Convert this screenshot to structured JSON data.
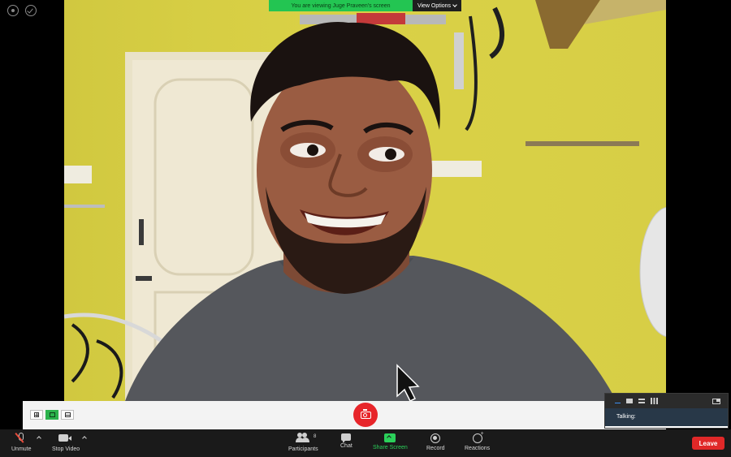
{
  "banner": {
    "message": "You are viewing Juge Praveen's screen",
    "options_label": "View Options"
  },
  "mini_panel": {
    "talking_label": "Talking:"
  },
  "toolbar": {
    "unmute_label": "Unmute",
    "stop_video_label": "Stop Video",
    "participants_label": "Participants",
    "participants_count": "8",
    "chat_label": "Chat",
    "share_screen_label": "Share Screen",
    "record_label": "Record",
    "reactions_label": "Reactions",
    "leave_label": "Leave"
  },
  "colors": {
    "share_green": "#2bd05a",
    "leave_red": "#e02828",
    "banner_green": "#23c552",
    "wall_yellow": "#d9d23e"
  }
}
